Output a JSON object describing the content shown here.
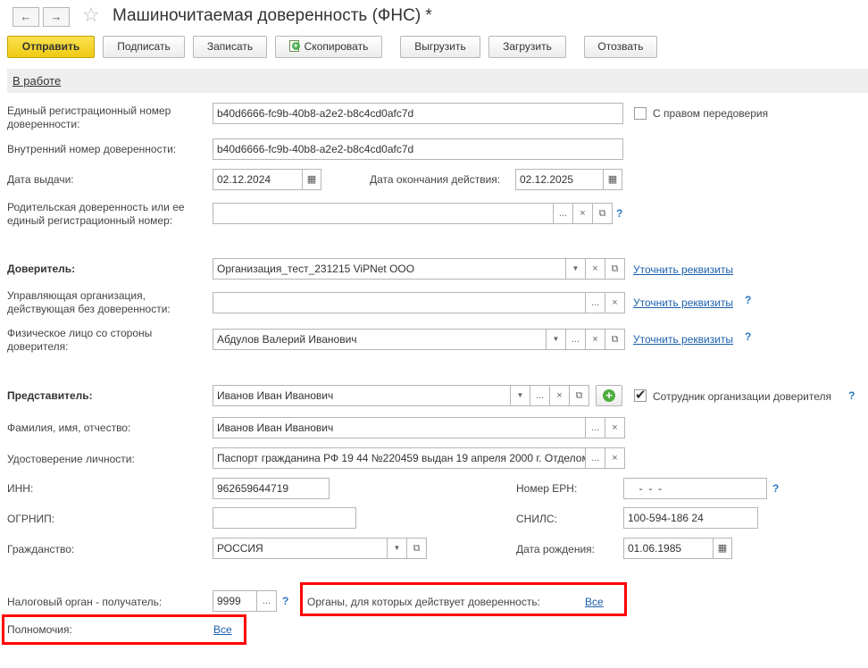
{
  "window": {
    "title": "Машиночитаемая доверенность (ФНС) *",
    "back_icon": "←",
    "forward_icon": "→",
    "star_icon": "☆"
  },
  "toolbar": {
    "send": "Отправить",
    "sign": "Подписать",
    "save": "Записать",
    "copy": "Скопировать",
    "export": "Выгрузить",
    "import": "Загрузить",
    "revoke": "Отозвать"
  },
  "status": {
    "label": "В работе"
  },
  "form": {
    "reg_number": {
      "label": "Единый регистрационный номер доверенности:",
      "value": "b40d6666-fc9b-40b8-a2e2-b8c4cd0afc7d"
    },
    "redelegation": {
      "label": "С правом передоверия",
      "checked": false
    },
    "internal_number": {
      "label": "Внутренний номер доверенности:",
      "value": "b40d6666-fc9b-40b8-a2e2-b8c4cd0afc7d"
    },
    "issue_date": {
      "label": "Дата выдачи:",
      "value": "02.12.2024"
    },
    "end_date": {
      "label": "Дата окончания действия:",
      "value": "02.12.2025"
    },
    "parent": {
      "label": "Родительская доверенность или ее единый регистрационный номер:",
      "value": ""
    },
    "principal": {
      "label": "Доверитель:",
      "value": "Организация_тест_231215 ViPNet ООО",
      "link": "Уточнить реквизиты"
    },
    "management_org": {
      "label": "Управляющая организация, действующая без доверенности:",
      "value": "",
      "link": "Уточнить реквизиты"
    },
    "individual": {
      "label": "Физическое лицо со стороны доверителя:",
      "value": "Абдулов Валерий Иванович",
      "link": "Уточнить реквизиты"
    },
    "representative": {
      "label": "Представитель:",
      "value": "Иванов Иван Иванович",
      "employee_label": "Сотрудник организации доверителя",
      "employee_checked": true
    },
    "full_name": {
      "label": "Фамилия, имя, отчество:",
      "value": "Иванов Иван Иванович"
    },
    "id_document": {
      "label": "Удостоверение личности:",
      "value": "Паспорт гражданина РФ 19 44 №220459 выдан 19 апреля 2000 г. Отделом внутренних дел"
    },
    "inn": {
      "label": "ИНН:",
      "value": "962659644719"
    },
    "ern": {
      "label": "Номер ЕРН:",
      "value": "  -  -  -"
    },
    "ogrnip": {
      "label": "ОГРНИП:",
      "value": ""
    },
    "snils": {
      "label": "СНИЛС:",
      "value": "100-594-186 24"
    },
    "citizenship": {
      "label": "Гражданство:",
      "value": "РОССИЯ"
    },
    "birth_date": {
      "label": "Дата рождения:",
      "value": "01.06.1985"
    },
    "tax_authority": {
      "label": "Налоговый орган - получатель:",
      "value": "9999"
    },
    "authorities": {
      "label": "Органы, для которых действует доверенность:",
      "link": "Все"
    },
    "powers": {
      "label": "Полномочия:",
      "link": "Все"
    }
  },
  "glyphs": {
    "help": "?",
    "ellipsis": "...",
    "clear": "×",
    "open": "⧉",
    "dropdown": "▼",
    "calendar": "▦",
    "add": "+"
  },
  "colors": {
    "accent_yellow": "#f2d028",
    "link_blue": "#1a5fad",
    "highlight_red": "#ff0000"
  }
}
